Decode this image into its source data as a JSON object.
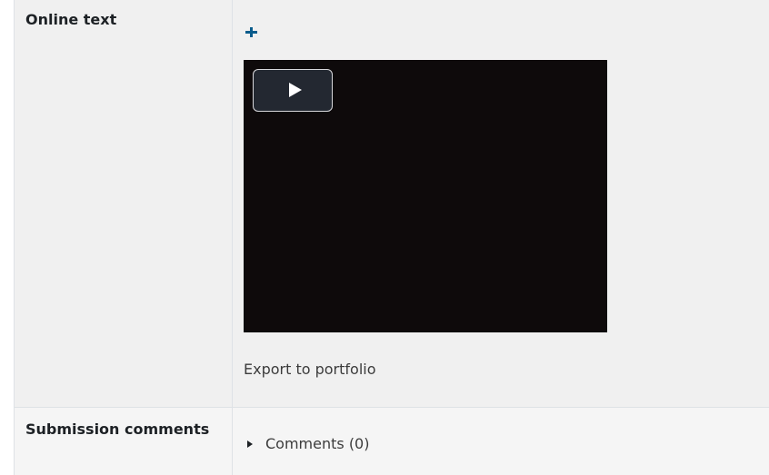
{
  "rows": {
    "online_text": {
      "label": "Online text",
      "export_link": "Export to portfolio"
    },
    "submission_comments": {
      "label": "Submission comments",
      "comments_toggle": "Comments (0)"
    }
  },
  "icons": {
    "expand": "plus-icon",
    "play": "play-icon",
    "comments_caret": "caret-right-icon"
  },
  "colors": {
    "accent": "#0a5c8c",
    "video_background": "#0e0a0b",
    "row_background": "#f0f0f0"
  }
}
